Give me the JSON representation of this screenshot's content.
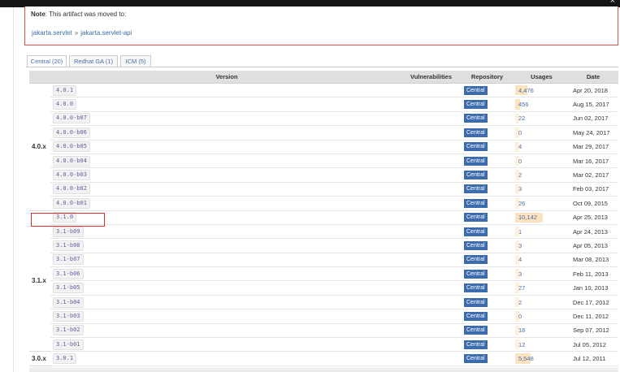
{
  "note": {
    "label": "Note",
    "text": ": This artifact was moved to:",
    "path": [
      "jakarta.servlet",
      "jakarta.servlet-api"
    ],
    "separator": "»"
  },
  "window": {
    "close_glyph": "×"
  },
  "tabs": [
    {
      "label": "Central (20)",
      "active": true
    },
    {
      "label": "Redhat GA (1)",
      "active": false
    },
    {
      "label": "ICM (5)",
      "active": false
    }
  ],
  "columns": [
    "Version",
    "Vulnerabilities",
    "Repository",
    "Usages",
    "Date"
  ],
  "groups": [
    {
      "label": "4.0.x",
      "rows": [
        {
          "version": "4.0.1",
          "repo": "Central",
          "usages": "4,476",
          "usage_level": 0.44,
          "date": "Apr 20, 2018"
        },
        {
          "version": "4.0.0",
          "repo": "Central",
          "usages": "456",
          "usage_level": 0.04,
          "date": "Aug 15, 2017"
        },
        {
          "version": "4.0.0-b07",
          "repo": "Central",
          "usages": "22",
          "usage_level": 0.0,
          "date": "Jun 02, 2017"
        },
        {
          "version": "4.0.0-b06",
          "repo": "Central",
          "usages": "0",
          "usage_level": 0.0,
          "date": "May 24, 2017"
        },
        {
          "version": "4.0.0-b05",
          "repo": "Central",
          "usages": "4",
          "usage_level": 0.0,
          "date": "Mar 29, 2017"
        },
        {
          "version": "4.0.0-b04",
          "repo": "Central",
          "usages": "0",
          "usage_level": 0.0,
          "date": "Mar 16, 2017"
        },
        {
          "version": "4.0.0-b03",
          "repo": "Central",
          "usages": "2",
          "usage_level": 0.0,
          "date": "Mar 02, 2017"
        },
        {
          "version": "4.0.0-b02",
          "repo": "Central",
          "usages": "3",
          "usage_level": 0.0,
          "date": "Feb 03, 2017"
        },
        {
          "version": "4.0.0-b01",
          "repo": "Central",
          "usages": "26",
          "usage_level": 0.0,
          "date": "Oct 09, 2015"
        }
      ]
    },
    {
      "label": "3.1.x",
      "rows": [
        {
          "version": "3.1.0",
          "repo": "Central",
          "usages": "10,142",
          "usage_level": 1.0,
          "date": "Apr 25, 2013"
        },
        {
          "version": "3.1-b09",
          "repo": "Central",
          "usages": "1",
          "usage_level": 0.0,
          "date": "Apr 24, 2013"
        },
        {
          "version": "3.1-b08",
          "repo": "Central",
          "usages": "3",
          "usage_level": 0.0,
          "date": "Apr 05, 2013"
        },
        {
          "version": "3.1-b07",
          "repo": "Central",
          "usages": "4",
          "usage_level": 0.0,
          "date": "Mar 08, 2013"
        },
        {
          "version": "3.1-b06",
          "repo": "Central",
          "usages": "3",
          "usage_level": 0.0,
          "date": "Feb 11, 2013"
        },
        {
          "version": "3.1-b05",
          "repo": "Central",
          "usages": "27",
          "usage_level": 0.0,
          "date": "Jan 10, 2013"
        },
        {
          "version": "3.1-b04",
          "repo": "Central",
          "usages": "2",
          "usage_level": 0.0,
          "date": "Dec 17, 2012"
        },
        {
          "version": "3.1-b03",
          "repo": "Central",
          "usages": "0",
          "usage_level": 0.0,
          "date": "Dec 11, 2012"
        },
        {
          "version": "3.1-b02",
          "repo": "Central",
          "usages": "18",
          "usage_level": 0.0,
          "date": "Sep 07, 2012"
        },
        {
          "version": "3.1-b01",
          "repo": "Central",
          "usages": "12",
          "usage_level": 0.0,
          "date": "Jul 05, 2012"
        }
      ]
    },
    {
      "label": "3.0.x",
      "rows": [
        {
          "version": "3.0.1",
          "repo": "Central",
          "usages": "5,548",
          "usage_level": 0.55,
          "date": "Jul 12, 2011"
        }
      ]
    }
  ],
  "colors": {
    "accent": "#3d6cae",
    "highlight": "#d9302c",
    "usage_bar": "#fbe3c0"
  }
}
